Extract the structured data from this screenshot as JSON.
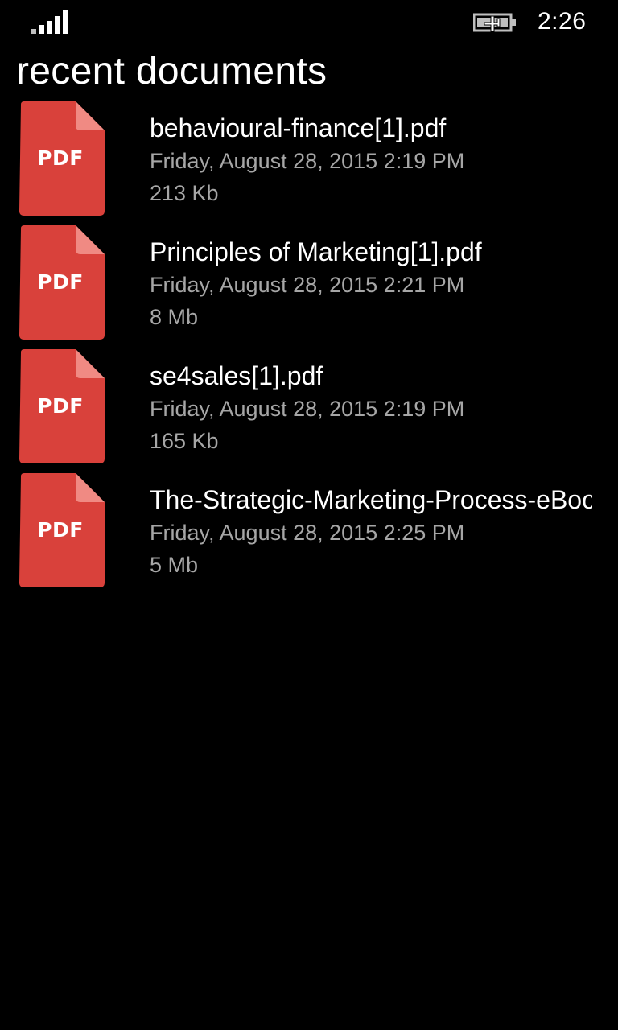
{
  "status_bar": {
    "signal_icon": "signal-strength-icon",
    "battery_icon": "battery-charging-icon",
    "time": "2:26"
  },
  "page": {
    "title": "recent documents"
  },
  "documents": [
    {
      "icon_label": "PDF",
      "name": "behavioural-finance[1].pdf",
      "date": "Friday, August 28, 2015 2:19 PM",
      "size": "213 Kb"
    },
    {
      "icon_label": "PDF",
      "name": "Principles of Marketing[1].pdf",
      "date": "Friday, August 28, 2015 2:21 PM",
      "size": "8 Mb"
    },
    {
      "icon_label": "PDF",
      "name": "se4sales[1].pdf",
      "date": "Friday, August 28, 2015 2:19 PM",
      "size": "165 Kb"
    },
    {
      "icon_label": "PDF",
      "name": "The-Strategic-Marketing-Process-eBook.pdf",
      "date": "Friday, August 28, 2015 2:25 PM",
      "size": "5 Mb"
    }
  ],
  "colors": {
    "background": "#000000",
    "pdf_red": "#d9413b",
    "pdf_fold": "#f08a83",
    "secondary_text": "#a6a6a6"
  }
}
